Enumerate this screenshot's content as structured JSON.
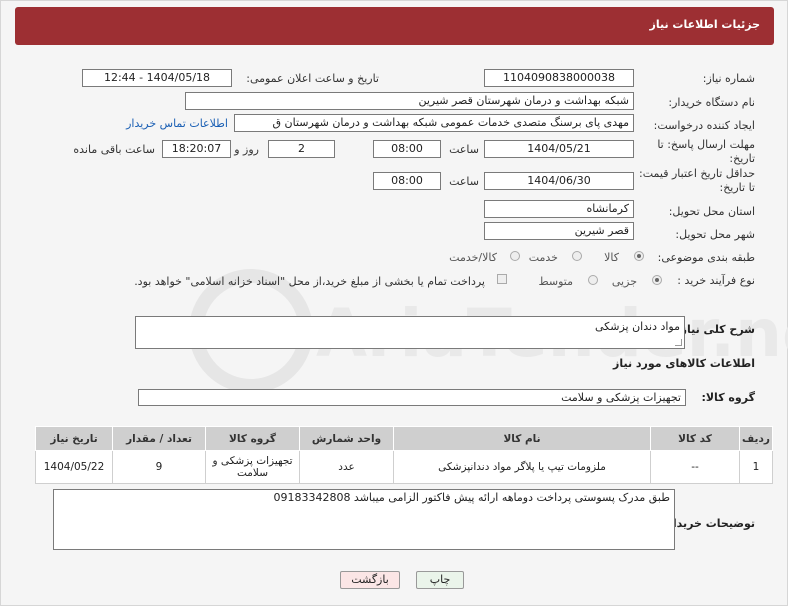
{
  "header": {
    "title": "جزئیات اطلاعات نیاز"
  },
  "fields": {
    "need_number_label": "شماره نیاز:",
    "need_number": "1104090838000038",
    "announce_label": "تاریخ و ساعت اعلان عمومی:",
    "announce_value": "1404/05/18 - 12:44",
    "buyer_org_label": "نام دستگاه خریدار:",
    "buyer_org": "شبکه بهداشت و درمان شهرستان قصر شیرین",
    "creator_label": "ایجاد کننده درخواست:",
    "creator": "مهدی پای برسنگ متصدی خدمات عمومی شبکه بهداشت و درمان شهرستان ق",
    "contact_link": "اطلاعات تماس خریدار",
    "deadline_label": "مهلت ارسال پاسخ: تا تاریخ:",
    "deadline_date": "1404/05/21",
    "time_label": "ساعت",
    "deadline_time": "08:00",
    "days_value": "2",
    "days_label": "روز و",
    "remaining_time": "18:20:07",
    "remaining_label": "ساعت باقی مانده",
    "price_validity_label": "حداقل تاریخ اعتبار قیمت: تا تاریخ:",
    "price_date": "1404/06/30",
    "price_time": "08:00",
    "province_label": "استان محل تحویل:",
    "province": "کرمانشاه",
    "city_label": "شهر محل تحویل:",
    "city": "قصر شیرین",
    "category_label": "طبقه بندی موضوعی:",
    "cat_goods": "کالا",
    "cat_service": "خدمت",
    "cat_both": "کالا/خدمت",
    "process_label": "نوع فرآیند خرید :",
    "proc_partial": "جزیی",
    "proc_medium": "متوسط",
    "payment_note": "پرداخت تمام یا بخشی از مبلغ خرید،از محل \"اسناد خزانه اسلامی\" خواهد بود."
  },
  "summary": {
    "label": "شرح کلی نیاز:",
    "value": "مواد دندان پزشکی"
  },
  "goods_section": {
    "title": "اطلاعات کالاهای مورد نیاز",
    "group_label": "گروه کالا:",
    "group_value": "تجهیزات پزشکی و سلامت"
  },
  "table": {
    "headers": [
      "ردیف",
      "کد کالا",
      "نام کالا",
      "واحد شمارش",
      "گروه کالا",
      "تعداد / مقدار",
      "تاریخ نیاز"
    ],
    "rows": [
      [
        "1",
        "--",
        "ملزومات تیپ یا پلاگر مواد دندانپزشکی",
        "عدد",
        "تجهیزات پزشکی و سلامت",
        "9",
        "1404/05/22"
      ]
    ]
  },
  "buyer_notes": {
    "label": "توضیحات خریدار:",
    "value": "طبق مدرک پسوستی پرداخت دوماهه ارائه پیش فاکتور الزامی میباشد 09183342808"
  },
  "buttons": {
    "print": "چاپ",
    "back": "بازگشت"
  },
  "watermark": {
    "text": "AriaTender.net"
  },
  "colors": {
    "header": "#9d2f33",
    "link": "#1a5fb4",
    "print_btn": "#e8f4e8",
    "back_btn": "#f8e4e4"
  }
}
